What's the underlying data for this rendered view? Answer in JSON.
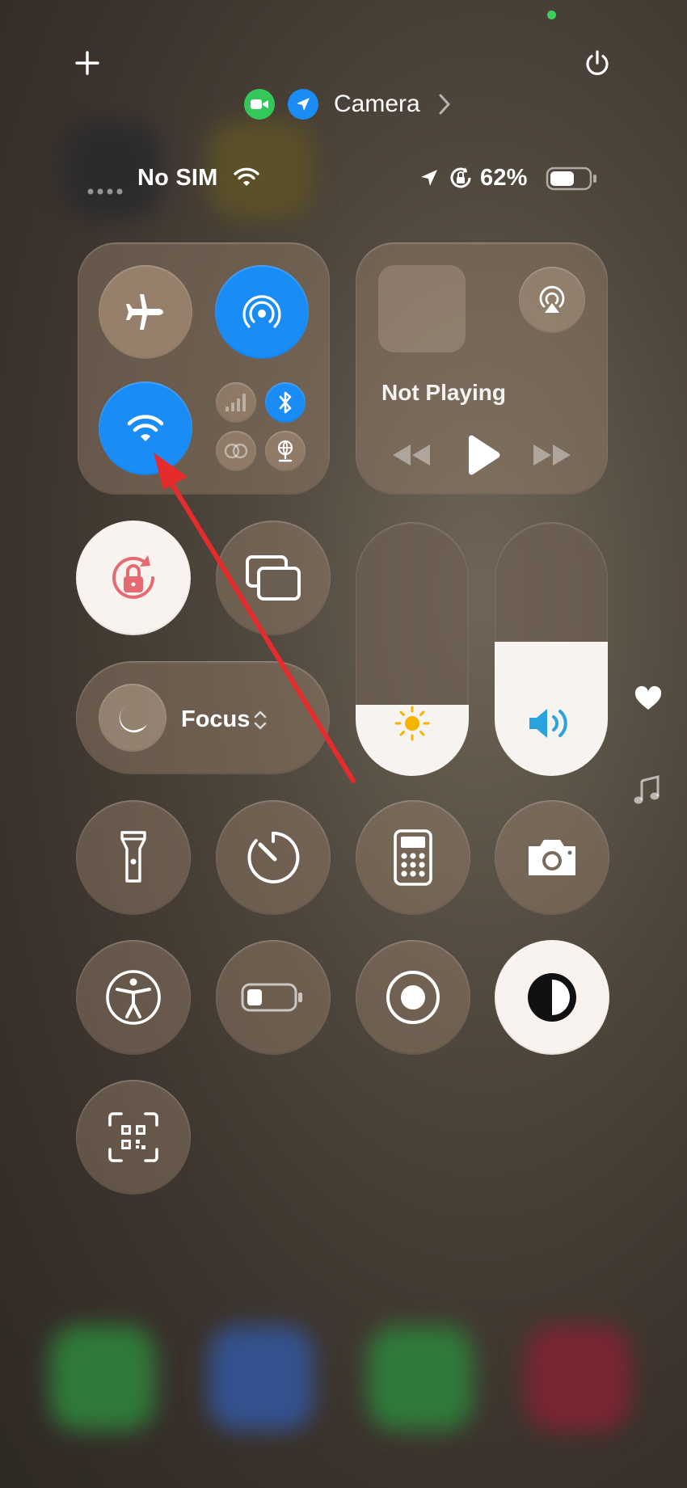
{
  "header": {
    "add_icon": "plus-icon",
    "power_icon": "power-icon",
    "indicator_app": "Camera",
    "indicator_icons": [
      "facetime-camera-icon",
      "location-arrow-icon"
    ],
    "indicator_dot_color": "#3ad15a"
  },
  "status_bar": {
    "carrier": "No SIM",
    "battery_percent": "62%",
    "battery_level": 0.62,
    "icons": [
      "signal-dots-icon",
      "wifi-icon",
      "location-icon",
      "orientation-lock-icon",
      "battery-icon"
    ]
  },
  "connectivity": {
    "airplane_mode": false,
    "airdrop": true,
    "wifi": true,
    "cellular": false,
    "bluetooth": true,
    "active_color": "#1a8cf5"
  },
  "media": {
    "status": "Not Playing",
    "controls": [
      "rewind-icon",
      "play-icon",
      "fast-forward-icon"
    ],
    "airplay_icon": "airplay-icon"
  },
  "controls": {
    "focus_label": "Focus",
    "brightness_level": 0.28,
    "volume_level": 0.53
  },
  "side_icons": [
    "heart-icon",
    "music-note-icon"
  ],
  "tiles": [
    "flashlight-icon",
    "timer-icon",
    "calculator-icon",
    "camera-icon",
    "accessibility-icon",
    "low-power-battery-icon",
    "screen-record-icon",
    "dark-mode-icon",
    "qr-scanner-icon"
  ],
  "annotation": {
    "arrow_color": "#e52b2b"
  }
}
